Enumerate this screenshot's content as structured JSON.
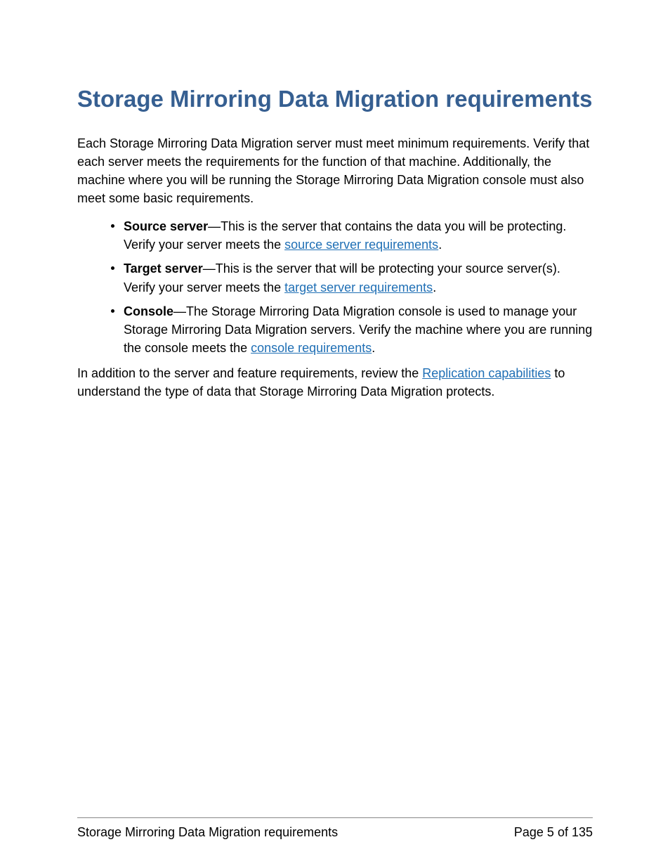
{
  "heading": "Storage Mirroring Data Migration requirements",
  "intro": "Each Storage Mirroring Data Migration server must meet minimum requirements. Verify that each server meets the requirements for the function of that machine. Additionally, the machine where you will be running the Storage Mirroring Data Migration console must also meet some basic requirements.",
  "items": [
    {
      "label": "Source server",
      "text_before_link": "—This is the server that contains the data you will be protecting. Verify your server meets the ",
      "link": "source server requirements",
      "text_after_link": "."
    },
    {
      "label": "Target server",
      "text_before_link": "—This is the server that will be protecting your source server(s). Verify your server meets the ",
      "link": "target server requirements",
      "text_after_link": "."
    },
    {
      "label": "Console",
      "text_before_link": "—The Storage Mirroring Data Migration console is used to manage your Storage Mirroring Data Migration servers. Verify the machine where you are running the console meets the ",
      "link": "console requirements",
      "text_after_link": "."
    }
  ],
  "closing": {
    "before_link": "In addition to the server and feature requirements, review the ",
    "link": "Replication capabilities",
    "after_link": " to understand the type of data that Storage Mirroring Data Migration protects."
  },
  "footer": {
    "title": "Storage Mirroring Data Migration requirements",
    "page": "Page 5 of 135"
  }
}
